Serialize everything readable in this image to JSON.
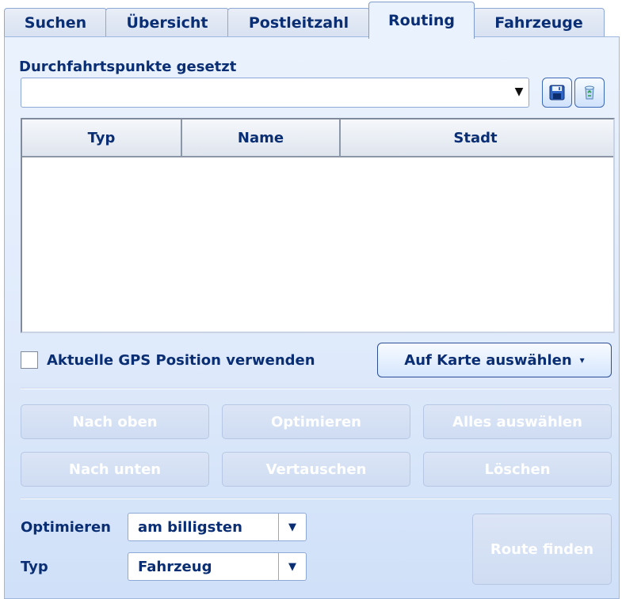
{
  "tabs": [
    "Suchen",
    "Übersicht",
    "Postleitzahl",
    "Routing",
    "Fahrzeuge"
  ],
  "active_tab": "Routing",
  "section_title": "Durchfahrtspunkte gesetzt",
  "combo": {
    "value": ""
  },
  "icons": {
    "save": "save-icon",
    "delete": "recycle-bin-icon",
    "dropdown": "dropdown-arrow-icon"
  },
  "table": {
    "columns": [
      "Typ",
      "Name",
      "Stadt"
    ],
    "rows": []
  },
  "gps_checkbox": {
    "label": "Aktuelle GPS Position verwenden",
    "checked": false
  },
  "choose_button": {
    "label": "Auf Karte auswählen",
    "caret": "▾"
  },
  "action_buttons": [
    [
      "Nach oben",
      "Optimieren",
      "Alles auswählen"
    ],
    [
      "Nach unten",
      "Vertauschen",
      "Löschen"
    ]
  ],
  "optimize": {
    "label": "Optimieren",
    "value": "am billigsten"
  },
  "type": {
    "label": "Typ",
    "value": "Fahrzeug"
  },
  "route_button": {
    "label": "Route finden",
    "enabled": false
  },
  "colors": {
    "accent": "#0a2e74",
    "panel": "#dfeafb",
    "border": "#8ea8d6"
  }
}
